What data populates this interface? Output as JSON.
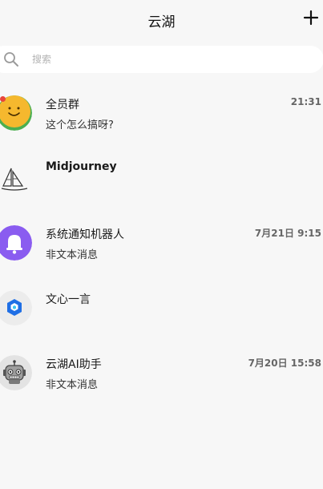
{
  "header": {
    "title": "云湖",
    "add_icon": "plus-icon"
  },
  "search": {
    "placeholder": "搜索",
    "icon": "search-icon"
  },
  "conversations": [
    {
      "name": "全员群",
      "preview": "这个怎么搞呀?",
      "time": "21:31",
      "avatar": "smiley-face-avatar",
      "unread": true
    },
    {
      "name": "Midjourney",
      "preview": "",
      "time": "",
      "avatar": "sailboat-logo-avatar",
      "unread": false
    },
    {
      "name": "系统通知机器人",
      "preview": "非文本消息",
      "time": "7月21日 9:15",
      "avatar": "bell-avatar",
      "unread": false
    },
    {
      "name": "文心一言",
      "preview": "",
      "time": "",
      "avatar": "ernie-logo-avatar",
      "unread": false
    },
    {
      "name": "云湖AI助手",
      "preview": "非文本消息",
      "time": "7月20日 15:58",
      "avatar": "robot-avatar",
      "unread": false
    }
  ],
  "colors": {
    "background": "#f7f7f7",
    "unread_dot": "#e8453c",
    "bell_avatar": "#8a5cf0",
    "ernie_blue": "#1f6fe5"
  }
}
